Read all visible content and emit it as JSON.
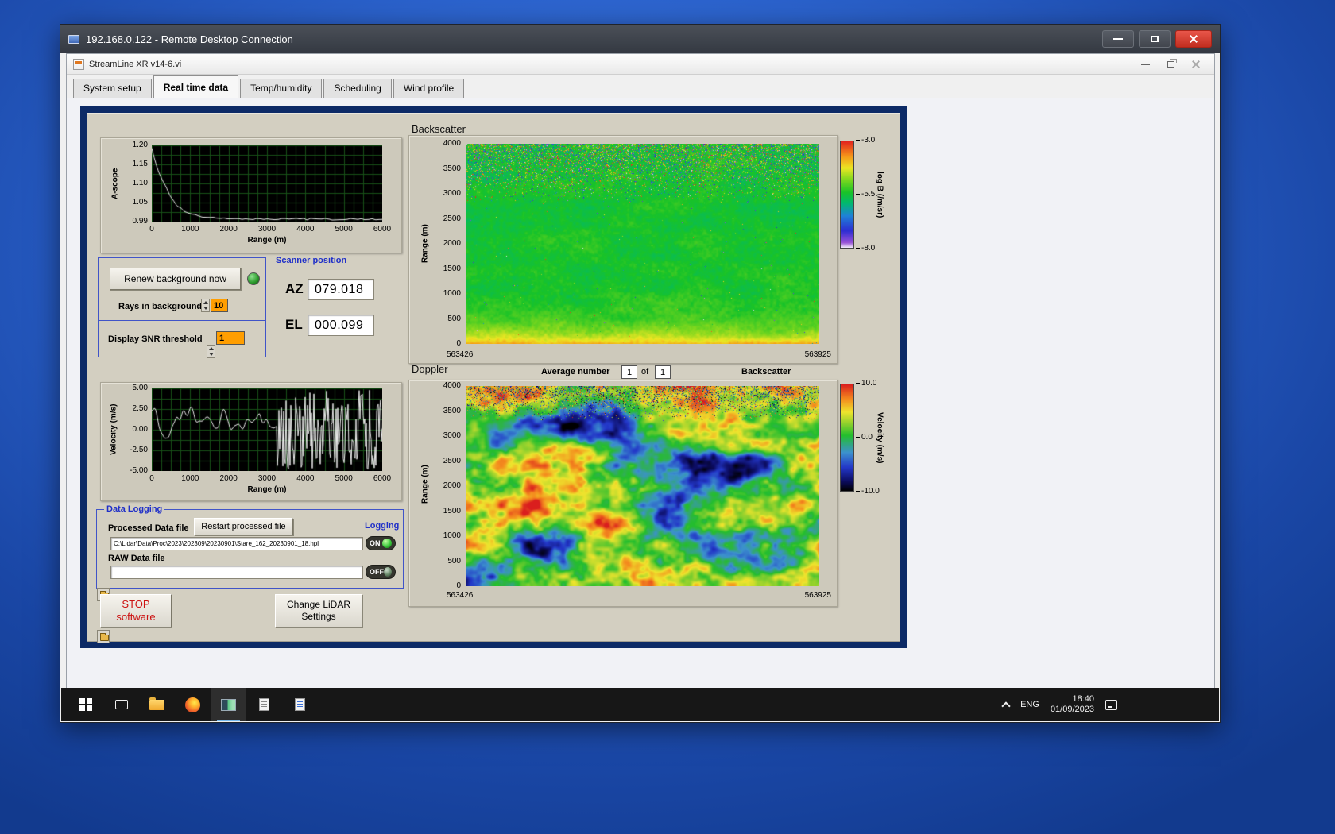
{
  "rdp": {
    "title": "192.168.0.122 - Remote Desktop Connection"
  },
  "vi": {
    "title": "StreamLine XR v14-6.vi",
    "tabs": [
      {
        "label": "System setup"
      },
      {
        "label": "Real time data"
      },
      {
        "label": "Temp/humidity"
      },
      {
        "label": "Scheduling"
      },
      {
        "label": "Wind profile"
      }
    ]
  },
  "panel": {
    "background": {
      "renew_button": "Renew background now",
      "rays_label": "Rays in background",
      "rays_value": "10",
      "snr_label": "Display SNR threshold",
      "snr_value": "1"
    },
    "scanner": {
      "title": "Scanner position",
      "az_label": "AZ",
      "az_value": "079.018",
      "el_label": "EL",
      "el_value": "000.099"
    },
    "doppler_header": {
      "avg_label": "Average number",
      "avg_value": "1",
      "of_label": "of",
      "avg_total": "1",
      "toggle_label": "Backscatter"
    },
    "logging": {
      "title": "Data Logging",
      "processed_label": "Processed Data file",
      "restart_button": "Restart processed file",
      "logging_label": "Logging",
      "processed_path": "C:\\Lidar\\Data\\Proc\\2023\\202309\\20230901\\Stare_162_20230901_18.hpl",
      "on_label": "ON",
      "raw_label": "RAW Data file",
      "raw_path": "",
      "off_label": "OFF"
    },
    "stop_button_line1": "STOP",
    "stop_button_line2": "software",
    "change_button_line1": "Change LiDAR",
    "change_button_line2": "Settings"
  },
  "charts": {
    "ascope": {
      "ylabel": "A-scope",
      "xlabel": "Range (m)",
      "yticks": [
        "1.20",
        "1.15",
        "1.10",
        "1.05",
        "0.99"
      ],
      "xticks": [
        "0",
        "1000",
        "2000",
        "3000",
        "4000",
        "5000",
        "6000"
      ]
    },
    "velocity": {
      "ylabel": "Velocity (m/s)",
      "xlabel": "Range (m)",
      "yticks": [
        "5.00",
        "2.50",
        "0.00",
        "-2.50",
        "-5.00"
      ],
      "xticks": [
        "0",
        "1000",
        "2000",
        "3000",
        "4000",
        "5000",
        "6000"
      ]
    },
    "backscatter": {
      "title": "Backscatter",
      "ylabel": "Range (m)",
      "yticks": [
        "4000",
        "3500",
        "3000",
        "2500",
        "2000",
        "1500",
        "1000",
        "500",
        "0"
      ],
      "x_start": "563426",
      "x_end": "563925",
      "cb_ticks": [
        "-3.0",
        "-5.5",
        "-8.0"
      ],
      "cb_label": "log B (/m/sr)"
    },
    "doppler": {
      "title": "Doppler",
      "ylabel": "Range (m)",
      "yticks": [
        "4000",
        "3500",
        "3000",
        "2500",
        "2000",
        "1500",
        "1000",
        "500",
        "0"
      ],
      "x_start": "563426",
      "x_end": "563925",
      "cb_ticks": [
        "10.0",
        "0.0",
        "-10.0"
      ],
      "cb_label": "Velocity (m/s)"
    }
  },
  "chart_data": [
    {
      "type": "line",
      "title": "A-scope",
      "xlabel": "Range (m)",
      "ylabel": "A-scope",
      "xlim": [
        0,
        6000
      ],
      "ylim": [
        0.99,
        1.2
      ],
      "x": [
        0,
        100,
        200,
        300,
        400,
        500,
        700,
        1000,
        1500,
        2000,
        3000,
        4000,
        5000,
        6000
      ],
      "y": [
        1.2,
        1.19,
        1.16,
        1.13,
        1.1,
        1.08,
        1.045,
        1.015,
        0.998,
        0.993,
        0.992,
        0.991,
        0.992,
        0.991
      ]
    },
    {
      "type": "line",
      "title": "Velocity",
      "xlabel": "Range (m)",
      "ylabel": "Velocity (m/s)",
      "xlim": [
        0,
        6000
      ],
      "ylim": [
        -5,
        5
      ],
      "description": "Noisy velocity trace oscillating within about +/-4 m/s up to ~3250 m; beyond ~3300 m the signal is uncorrelated noise spanning the full +/-5 m/s scale, appearing as dense vertical lines."
    },
    {
      "type": "heatmap",
      "title": "Backscatter",
      "x_range": [
        563426,
        563925
      ],
      "ylabel": "Range (m)",
      "y_range": [
        0,
        4000
      ],
      "z_label": "log B (/m/sr)",
      "z_range": [
        -8,
        -3
      ],
      "description": "Attenuated backscatter: mostly ~-5.5 (green) through the column, brightening to ~-4 (yellow/orange) below ~500 m; random multicolour speckle noise above ~3000 m."
    },
    {
      "type": "heatmap",
      "title": "Doppler",
      "x_range": [
        563426,
        563925
      ],
      "ylabel": "Range (m)",
      "y_range": [
        0,
        4000
      ],
      "z_label": "Velocity (m/s)",
      "z_range": [
        -10,
        10
      ],
      "description": "Doppler velocity: mottled field around 0 m/s (green) with coherent patches of +2..+6 m/s (yellow/orange/red) and -2..-8 m/s (blue/navy); uncorrelated speckle above ~3400 m."
    }
  ],
  "taskbar": {
    "tray": {
      "language": "ENG",
      "time": "18:40",
      "date": "01/09/2023"
    }
  },
  "colors": {
    "desktop_blue": "#2a5fc8",
    "panel_navy": "#0c2a66",
    "panel_tan": "#d3cfc1",
    "group_border_blue": "#4054c8",
    "value_orange": "#ff9e00",
    "led_green": "#2f9e2f",
    "close_red": "#d8322a"
  }
}
